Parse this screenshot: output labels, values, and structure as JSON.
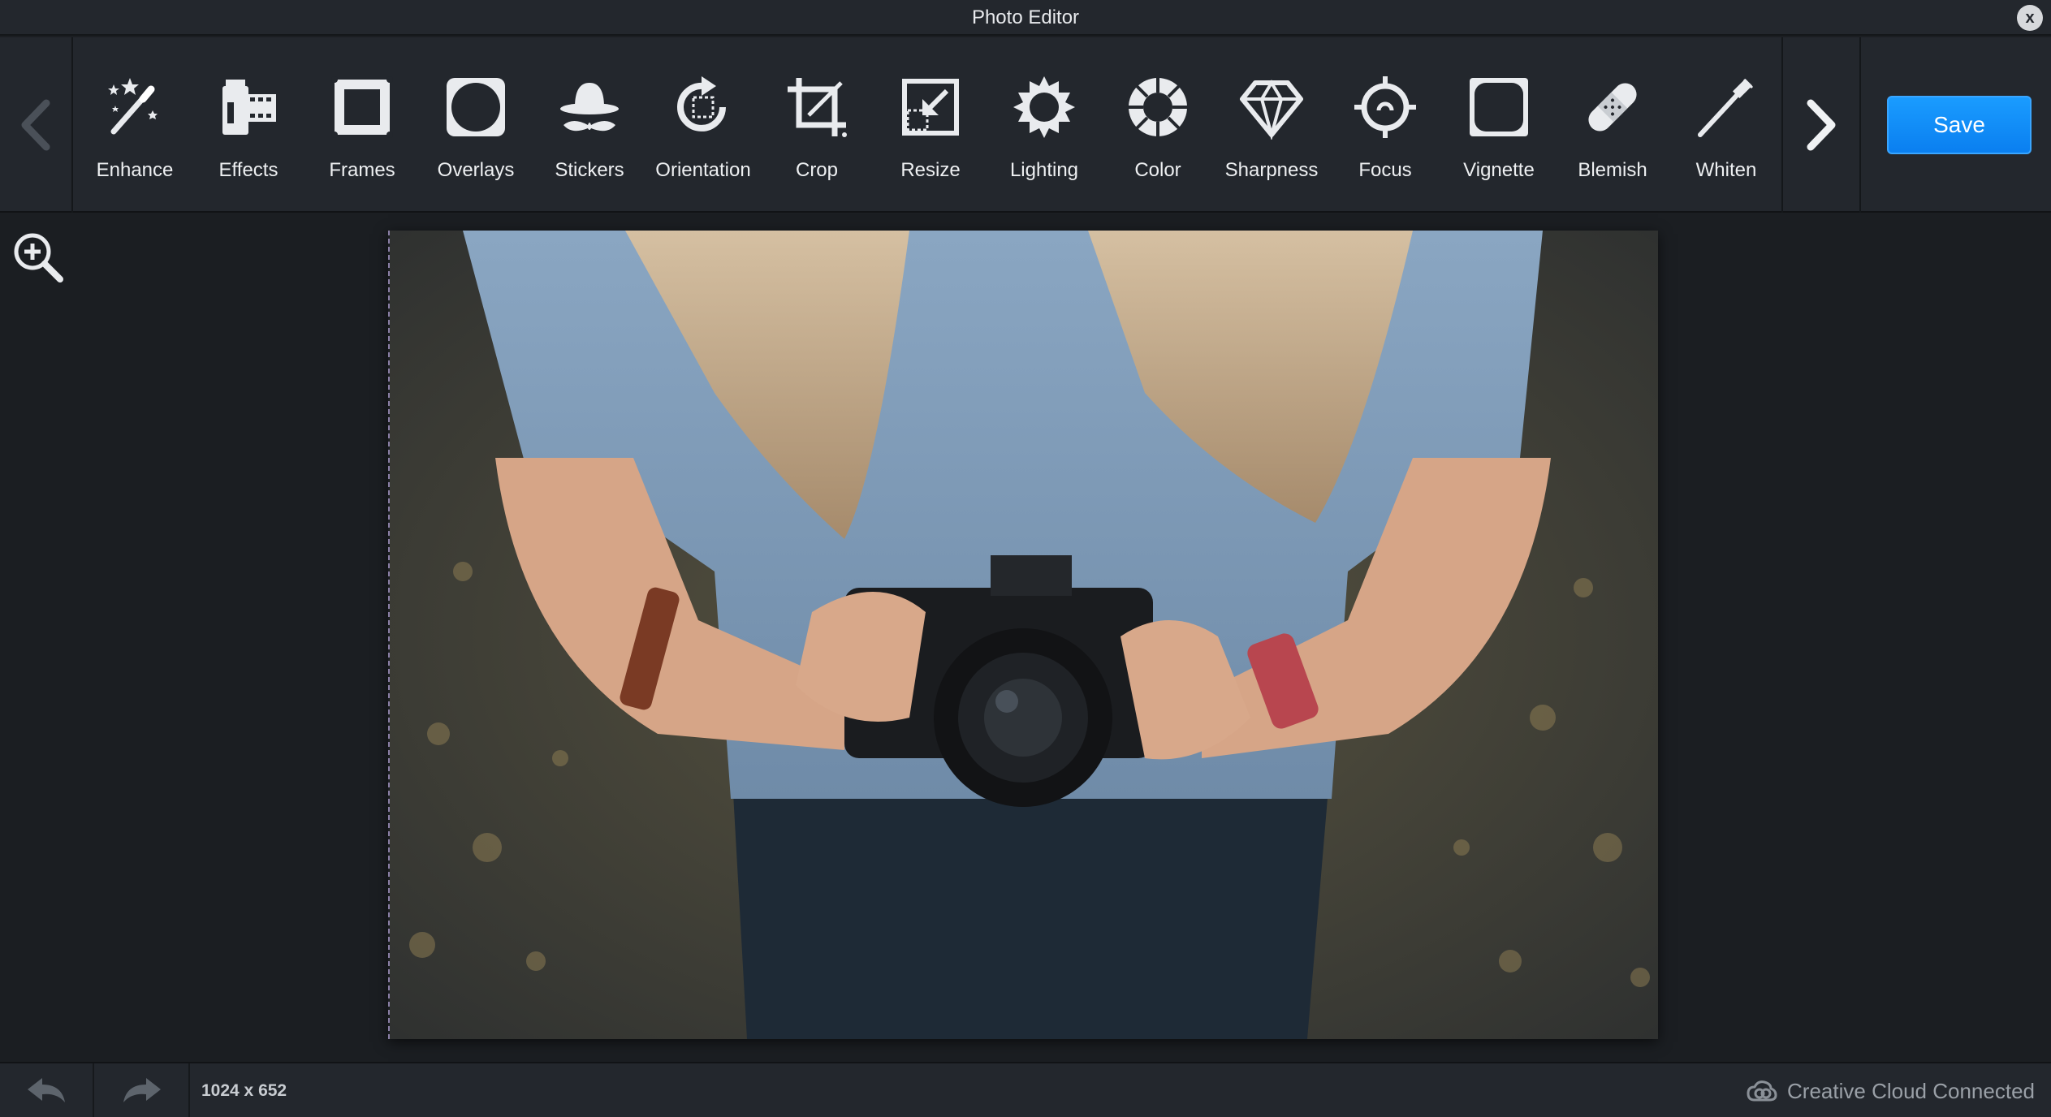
{
  "window": {
    "title": "Photo Editor",
    "close_label": "x"
  },
  "toolbar": {
    "prev_icon": "chevron-left-icon",
    "next_icon": "chevron-right-icon",
    "save_label": "Save",
    "tools": [
      {
        "label": "Enhance",
        "icon": "magic-wand-icon"
      },
      {
        "label": "Effects",
        "icon": "film-icon"
      },
      {
        "label": "Frames",
        "icon": "frame-icon"
      },
      {
        "label": "Overlays",
        "icon": "overlay-icon"
      },
      {
        "label": "Stickers",
        "icon": "hat-mustache-icon"
      },
      {
        "label": "Orientation",
        "icon": "rotate-icon"
      },
      {
        "label": "Crop",
        "icon": "crop-icon"
      },
      {
        "label": "Resize",
        "icon": "resize-icon"
      },
      {
        "label": "Lighting",
        "icon": "sun-icon"
      },
      {
        "label": "Color",
        "icon": "color-wheel-icon"
      },
      {
        "label": "Sharpness",
        "icon": "diamond-icon"
      },
      {
        "label": "Focus",
        "icon": "crosshair-icon"
      },
      {
        "label": "Vignette",
        "icon": "vignette-icon"
      },
      {
        "label": "Blemish",
        "icon": "bandage-icon"
      },
      {
        "label": "Whiten",
        "icon": "toothbrush-icon"
      }
    ]
  },
  "workspace": {
    "zoom_icon": "zoom-in-icon"
  },
  "statusbar": {
    "image_size": "1024 x 652",
    "cloud_status": "Creative Cloud Connected"
  },
  "colors": {
    "accent": "#0a7ff0",
    "toolbar_bg": "#23272d",
    "canvas_bg": "#1b1e22"
  }
}
